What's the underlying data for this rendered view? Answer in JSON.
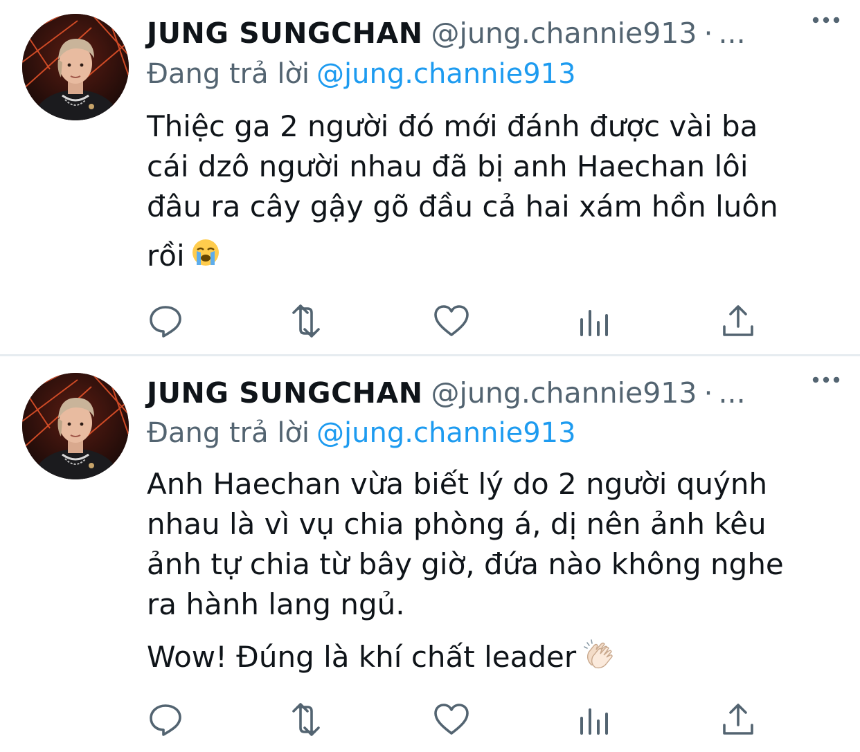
{
  "colors": {
    "text": "#0f1419",
    "secondary": "#536471",
    "link": "#1d9bf0",
    "separator": "#e6ecf0",
    "icon": "#536471"
  },
  "tweets": [
    {
      "display_name": "JUNG SUNGCHAN",
      "handle": "@jung.channie913",
      "dot": "·",
      "ellipsis": "...",
      "reply_prefix": "Đang trả lời",
      "reply_to": "@jung.channie913",
      "lines": [
        "Thiệc ga 2 người đó mới đánh được vài ba",
        "cái dzô người nhau đã bị anh Haechan lôi",
        "đâu ra cây gậy gõ đầu cả hai xám hồn luôn",
        "rồi"
      ],
      "emoji": "loudly-crying-face",
      "icons": [
        "reply-icon",
        "retweet-icon",
        "like-icon",
        "stats-icon",
        "share-icon"
      ]
    },
    {
      "display_name": "JUNG SUNGCHAN",
      "handle": "@jung.channie913",
      "dot": "·",
      "ellipsis": "...",
      "reply_prefix": "Đang trả lời",
      "reply_to": "@jung.channie913",
      "lines": [
        "Anh Haechan vừa biết lý do 2 người quýnh",
        "nhau là vì vụ chia phòng á, dị nên ảnh kêu",
        "ảnh tự chia từ bây giờ, đứa nào không nghe",
        "ra hành lang ngủ."
      ],
      "line_2": "Wow! Đúng là khí chất leader",
      "emoji": "clapping-hands",
      "icons": [
        "reply-icon",
        "retweet-icon",
        "like-icon",
        "stats-icon",
        "share-icon"
      ]
    }
  ]
}
